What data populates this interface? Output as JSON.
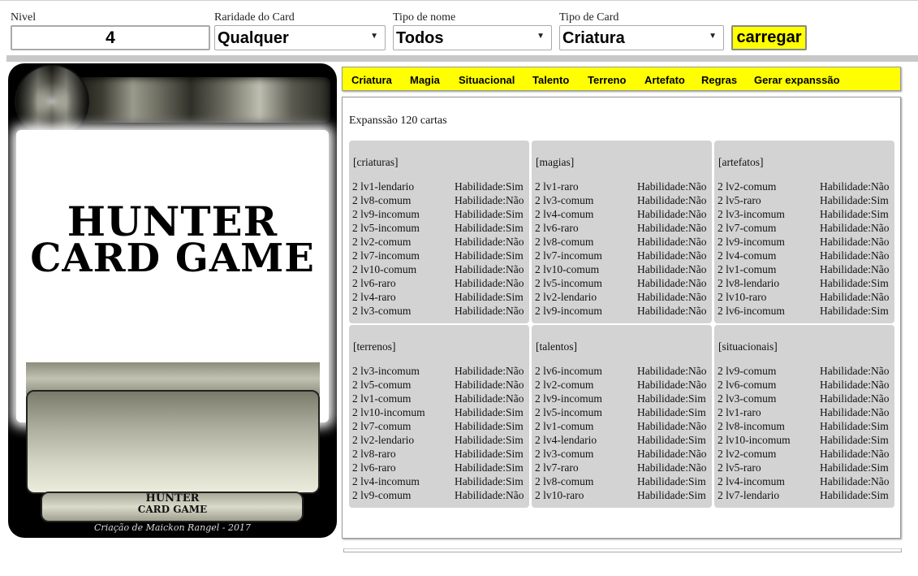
{
  "toolbar": {
    "nivel": {
      "label": "Nivel",
      "value": "4"
    },
    "raridade": {
      "label": "Raridade do Card",
      "selected": "Qualquer"
    },
    "tipo_nome": {
      "label": "Tipo de nome",
      "selected": "Todos"
    },
    "tipo_card": {
      "label": "Tipo de Card",
      "selected": "Criatura"
    },
    "load_label": "carregar",
    "accent": "#ffff00"
  },
  "card": {
    "title_line1": "HUNTER",
    "title_line2": "CARD GAME",
    "footer_line1": "HUNTER",
    "footer_line2": "CARD GAME",
    "credit": "Criação de Maickon Rangel - 2017"
  },
  "tabs": [
    "Criatura",
    "Magia",
    "Situacional",
    "Talento",
    "Terreno",
    "Artefato",
    "Regras",
    "Gerar expanssão"
  ],
  "expansion": {
    "title": "Expanssão 120 cartas",
    "groups": [
      {
        "title": "[criaturas]",
        "rows": [
          [
            "2 lv1-lendario",
            "Habilidade:Sim"
          ],
          [
            "2 lv8-comum",
            "Habilidade:Não"
          ],
          [
            "2 lv9-incomum",
            "Habilidade:Sim"
          ],
          [
            "2 lv5-incomum",
            "Habilidade:Sim"
          ],
          [
            "2 lv2-comum",
            "Habilidade:Não"
          ],
          [
            "2 lv7-incomum",
            "Habilidade:Sim"
          ],
          [
            "2 lv10-comum",
            "Habilidade:Não"
          ],
          [
            "2 lv6-raro",
            "Habilidade:Não"
          ],
          [
            "2 lv4-raro",
            "Habilidade:Sim"
          ],
          [
            "2 lv3-comum",
            "Habilidade:Não"
          ]
        ]
      },
      {
        "title": "[magias]",
        "rows": [
          [
            "2 lv1-raro",
            "Habilidade:Não"
          ],
          [
            "2 lv3-comum",
            "Habilidade:Não"
          ],
          [
            "2 lv4-comum",
            "Habilidade:Não"
          ],
          [
            "2 lv6-raro",
            "Habilidade:Não"
          ],
          [
            "2 lv8-comum",
            "Habilidade:Não"
          ],
          [
            "2 lv7-incomum",
            "Habilidade:Não"
          ],
          [
            "2 lv10-comum",
            "Habilidade:Não"
          ],
          [
            "2 lv5-incomum",
            "Habilidade:Não"
          ],
          [
            "2 lv2-lendario",
            "Habilidade:Não"
          ],
          [
            "2 lv9-incomum",
            "Habilidade:Não"
          ]
        ]
      },
      {
        "title": "[artefatos]",
        "rows": [
          [
            "2 lv2-comum",
            "Habilidade:Não"
          ],
          [
            "2 lv5-raro",
            "Habilidade:Sim"
          ],
          [
            "2 lv3-incomum",
            "Habilidade:Sim"
          ],
          [
            "2 lv7-comum",
            "Habilidade:Não"
          ],
          [
            "2 lv9-incomum",
            "Habilidade:Não"
          ],
          [
            "2 lv4-comum",
            "Habilidade:Não"
          ],
          [
            "2 lv1-comum",
            "Habilidade:Não"
          ],
          [
            "2 lv8-lendario",
            "Habilidade:Sim"
          ],
          [
            "2 lv10-raro",
            "Habilidade:Não"
          ],
          [
            "2 lv6-incomum",
            "Habilidade:Sim"
          ]
        ]
      },
      {
        "title": "[terrenos]",
        "rows": [
          [
            "2 lv3-incomum",
            "Habilidade:Não"
          ],
          [
            "2 lv5-comum",
            "Habilidade:Não"
          ],
          [
            "2 lv1-comum",
            "Habilidade:Não"
          ],
          [
            "2 lv10-incomum",
            "Habilidade:Sim"
          ],
          [
            "2 lv7-comum",
            "Habilidade:Sim"
          ],
          [
            "2 lv2-lendario",
            "Habilidade:Sim"
          ],
          [
            "2 lv8-raro",
            "Habilidade:Sim"
          ],
          [
            "2 lv6-raro",
            "Habilidade:Sim"
          ],
          [
            "2 lv4-incomum",
            "Habilidade:Sim"
          ],
          [
            "2 lv9-comum",
            "Habilidade:Não"
          ]
        ]
      },
      {
        "title": "[talentos]",
        "rows": [
          [
            "2 lv6-incomum",
            "Habilidade:Não"
          ],
          [
            "2 lv2-comum",
            "Habilidade:Não"
          ],
          [
            "2 lv9-incomum",
            "Habilidade:Sim"
          ],
          [
            "2 lv5-incomum",
            "Habilidade:Sim"
          ],
          [
            "2 lv1-comum",
            "Habilidade:Não"
          ],
          [
            "2 lv4-lendario",
            "Habilidade:Sim"
          ],
          [
            "2 lv3-comum",
            "Habilidade:Não"
          ],
          [
            "2 lv7-raro",
            "Habilidade:Não"
          ],
          [
            "2 lv8-comum",
            "Habilidade:Sim"
          ],
          [
            "2 lv10-raro",
            "Habilidade:Sim"
          ]
        ]
      },
      {
        "title": "[situacionais]",
        "rows": [
          [
            "2 lv9-comum",
            "Habilidade:Não"
          ],
          [
            "2 lv6-comum",
            "Habilidade:Não"
          ],
          [
            "2 lv3-comum",
            "Habilidade:Não"
          ],
          [
            "2 lv1-raro",
            "Habilidade:Não"
          ],
          [
            "2 lv8-incomum",
            "Habilidade:Sim"
          ],
          [
            "2 lv10-incomum",
            "Habilidade:Sim"
          ],
          [
            "2 lv2-comum",
            "Habilidade:Não"
          ],
          [
            "2 lv5-raro",
            "Habilidade:Sim"
          ],
          [
            "2 lv4-incomum",
            "Habilidade:Não"
          ],
          [
            "2 lv7-lendario",
            "Habilidade:Sim"
          ]
        ]
      }
    ]
  }
}
